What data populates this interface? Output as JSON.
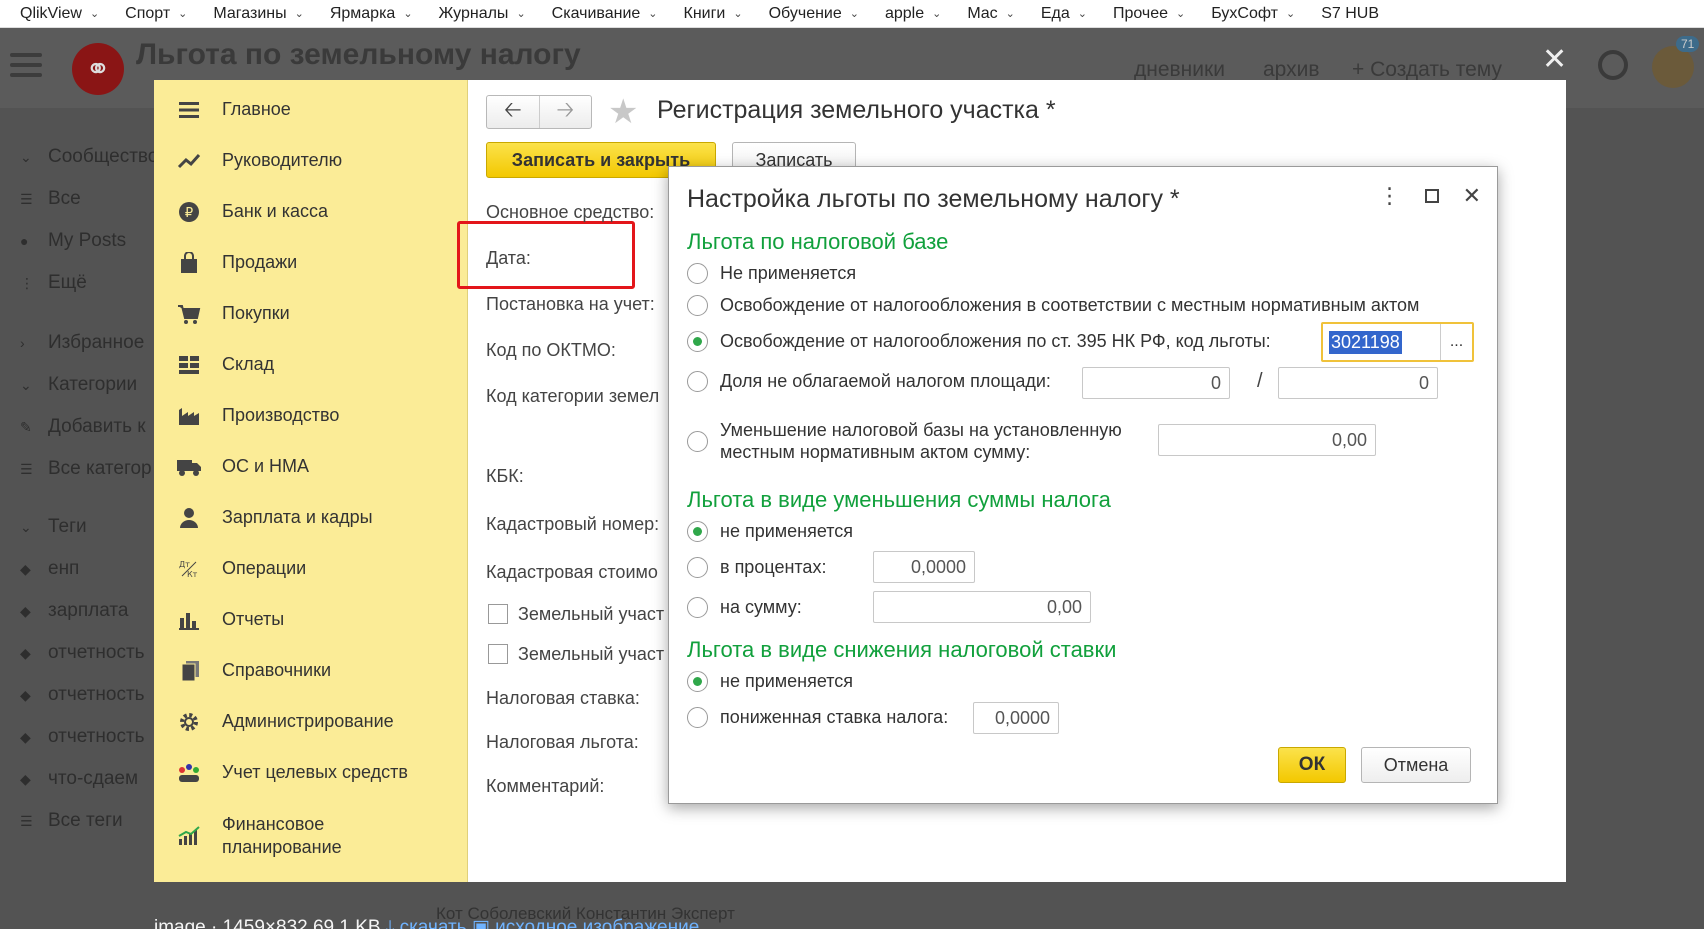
{
  "bookmarks": [
    {
      "label": "QlikView"
    },
    {
      "label": "Спорт"
    },
    {
      "label": "Магазины"
    },
    {
      "label": "Ярмарка"
    },
    {
      "label": "Журналы"
    },
    {
      "label": "Скачивание"
    },
    {
      "label": "Книги"
    },
    {
      "label": "Обучение"
    },
    {
      "label": "apple"
    },
    {
      "label": "Mac"
    },
    {
      "label": "Еда"
    },
    {
      "label": "Прочее"
    },
    {
      "label": "БухСофт"
    },
    {
      "label": "S7 HUB"
    }
  ],
  "forum": {
    "title": "Льгота по земельному налогу",
    "nav_diaries": "дневники",
    "nav_archive": "архив",
    "nav_create": "+ Создать тему",
    "badge": "71",
    "sidebar": [
      "Сообщество",
      "Все",
      "My Posts",
      "Ещё",
      "Избранное",
      "Категории",
      "Добавить к",
      "Все категор",
      "Теги",
      "енп",
      "зарплата",
      "отчетность",
      "отчетность",
      "отчетность",
      "что-сдаем",
      "Все теги"
    ],
    "author_line": "Кот  Соболевский Константин  Эксперт",
    "caption_info": "image · 1459×832 69.1 KB",
    "caption_download": "скачать",
    "caption_original": "исходное изображение"
  },
  "sidebar_1c": [
    {
      "label": "Главное",
      "icon": "menu-lines-icon"
    },
    {
      "label": "Руководителю",
      "icon": "trend-chart-icon"
    },
    {
      "label": "Банк и касса",
      "icon": "ruble-coin-icon"
    },
    {
      "label": "Продажи",
      "icon": "shopping-bag-icon"
    },
    {
      "label": "Покупки",
      "icon": "shopping-cart-icon"
    },
    {
      "label": "Склад",
      "icon": "warehouse-grid-icon"
    },
    {
      "label": "Производство",
      "icon": "factory-icon"
    },
    {
      "label": "ОС и НМА",
      "icon": "truck-icon"
    },
    {
      "label": "Зарплата и кадры",
      "icon": "person-icon"
    },
    {
      "label": "Операции",
      "icon": "dt-kt-icon"
    },
    {
      "label": "Отчеты",
      "icon": "bar-chart-icon"
    },
    {
      "label": "Справочники",
      "icon": "books-icon"
    },
    {
      "label": "Администрирование",
      "icon": "gear-icon"
    },
    {
      "label": "Учет целевых средств",
      "icon": "people-group-icon"
    },
    {
      "label": "Финансовое планирование",
      "icon": "growth-chart-icon"
    }
  ],
  "form": {
    "title": "Регистрация земельного участка *",
    "save_close": "Записать и закрыть",
    "save": "Записать",
    "labels": [
      "Основное средство:",
      "Дата:",
      "Постановка на учет:",
      "Код по ОКТМО:",
      "Код категории земел",
      "КБК:",
      "Кадастровый номер:",
      "Кадастровая стоимо",
      "Земельный участ",
      "Земельный участ",
      "Налоговая ставка:",
      "Налоговая льгота:",
      "Комментарий:"
    ]
  },
  "dialog": {
    "title": "Настройка льготы по земельному налогу *",
    "sec_base": "Льгота по налоговой базе",
    "base_options": [
      "Не применяется",
      "Освобождение от налогообложения в соответствии с местным нормативным актом",
      "Освобождение от налогообложения по ст. 395 НК РФ, код льготы:",
      "Доля не облагаемой налогом площади:",
      "Уменьшение налоговой базы на установленную",
      "местным нормативным актом сумму:"
    ],
    "code_value": "3021198",
    "code_btn": "...",
    "share_num": "0",
    "share_den": "0",
    "reduce_amount": "0,00",
    "sec_sum": "Льгота в виде уменьшения суммы налога",
    "sum_options": [
      "не применяется",
      "в процентах:",
      "на сумму:"
    ],
    "percent_value": "0,0000",
    "sum_value": "0,00",
    "sec_rate": "Льгота в виде снижения налоговой ставки",
    "rate_options": [
      "не применяется",
      "пониженная ставка налога:"
    ],
    "rate_value": "0,0000",
    "ok": "ОК",
    "cancel": "Отмена"
  }
}
